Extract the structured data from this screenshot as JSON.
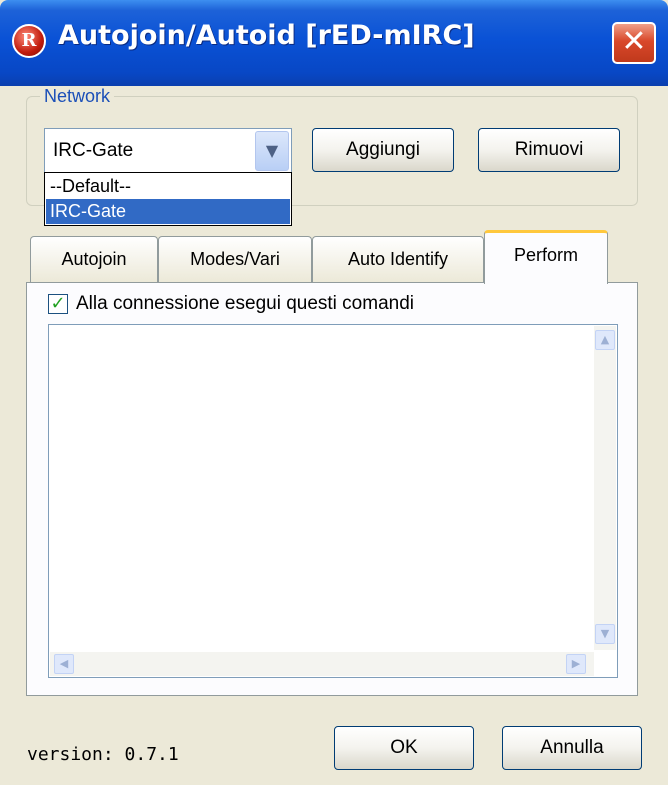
{
  "window": {
    "title": "Autojoin/Autoid [rED-mIRC]",
    "icon": "R",
    "close_label": "✕"
  },
  "network": {
    "legend": "Network",
    "selected": "IRC-Gate",
    "options": [
      "--Default--",
      "IRC-Gate"
    ],
    "add_label": "Aggiungi",
    "remove_label": "Rimuovi"
  },
  "tabs": [
    {
      "label": "Autojoin"
    },
    {
      "label": "Modes/Vari"
    },
    {
      "label": "Auto Identify"
    },
    {
      "label": "Perform"
    }
  ],
  "perform": {
    "checkbox_label": "Alla connessione esegui questi comandi",
    "checked": true,
    "commands": ""
  },
  "footer": {
    "version": "version: 0.7.1",
    "ok_label": "OK",
    "cancel_label": "Annulla"
  },
  "colors": {
    "titlebar": "#0a52d6",
    "selection": "#316ac5",
    "active_tab_accent": "#ffc83c",
    "group_legend": "#1b4fb8"
  }
}
